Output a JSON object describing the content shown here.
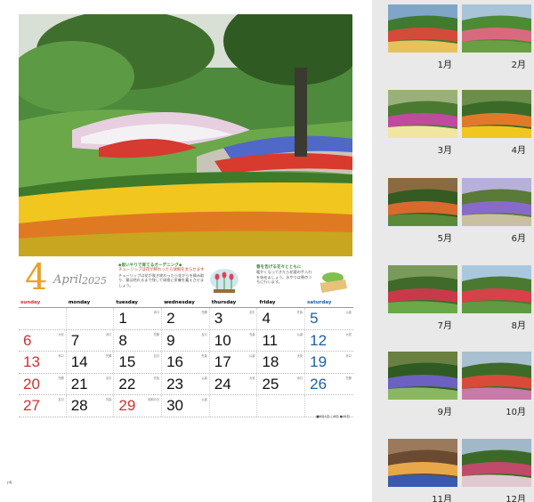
{
  "calendar": {
    "month_number": "4",
    "month_name": "April",
    "year": "2025",
    "weekdays": [
      "sunday",
      "monday",
      "tuesday",
      "wednesday",
      "thursday",
      "friday",
      "saturday"
    ],
    "weeks": [
      [
        {
          "d": ""
        },
        {
          "d": ""
        },
        {
          "d": "1",
          "n": "赤口"
        },
        {
          "d": "2",
          "n": "先勝"
        },
        {
          "d": "3",
          "n": "友引"
        },
        {
          "d": "4",
          "n": "先負"
        },
        {
          "d": "5",
          "n": "仏滅"
        }
      ],
      [
        {
          "d": "6",
          "n": "大安"
        },
        {
          "d": "7",
          "n": "赤口"
        },
        {
          "d": "8",
          "n": "先勝"
        },
        {
          "d": "9",
          "n": "友引"
        },
        {
          "d": "10",
          "n": "先負"
        },
        {
          "d": "11",
          "n": "仏滅"
        },
        {
          "d": "12",
          "n": "大安"
        }
      ],
      [
        {
          "d": "13",
          "n": "赤口"
        },
        {
          "d": "14",
          "n": "先勝"
        },
        {
          "d": "15",
          "n": "友引"
        },
        {
          "d": "16",
          "n": "先負"
        },
        {
          "d": "17",
          "n": "仏滅"
        },
        {
          "d": "18",
          "n": "大安"
        },
        {
          "d": "19",
          "n": "赤口"
        }
      ],
      [
        {
          "d": "20",
          "n": "先勝"
        },
        {
          "d": "21",
          "n": "友引"
        },
        {
          "d": "22",
          "n": "先負"
        },
        {
          "d": "23",
          "n": "仏滅"
        },
        {
          "d": "24",
          "n": "大安"
        },
        {
          "d": "25",
          "n": "赤口"
        },
        {
          "d": "26",
          "n": "先勝"
        }
      ],
      [
        {
          "d": "27",
          "n": "友引"
        },
        {
          "d": "28",
          "n": "先負"
        },
        {
          "d": "29",
          "n": "昭和の日",
          "hol": true
        },
        {
          "d": "30",
          "n": "仏滅"
        },
        {
          "d": ""
        },
        {
          "d": ""
        },
        {
          "d": ""
        }
      ]
    ],
    "footer_note": "■6月1日 ○8日 ●28日",
    "page_number": "r4"
  },
  "tips": {
    "tip1_title": "◆思いやりで育てるガーデニング◆",
    "tip1_sub": "チューリップは花が終わったら球根を太らせます",
    "tip1_body": "チューリップは花が咲き終わったら花がらを摘み取り、葉は枯れるまで残して球根に栄養を蓄えさせましょう。",
    "tip2_title": "春を告げる花々とともに",
    "tip2_body": "暖かくなってきたら花壇の手入れを始めましょう。水やりは朝のうちに行います。"
  },
  "thumbnails": [
    {
      "label": "1月"
    },
    {
      "label": "2月"
    },
    {
      "label": "3月"
    },
    {
      "label": "4月"
    },
    {
      "label": "5月"
    },
    {
      "label": "6月"
    },
    {
      "label": "7月"
    },
    {
      "label": "8月"
    },
    {
      "label": "9月"
    },
    {
      "label": "10月"
    },
    {
      "label": "11月"
    },
    {
      "label": "12月"
    }
  ],
  "colors": {
    "sunday": "#d0302e",
    "saturday": "#1d5fa6",
    "accent": "#e8a22a"
  }
}
